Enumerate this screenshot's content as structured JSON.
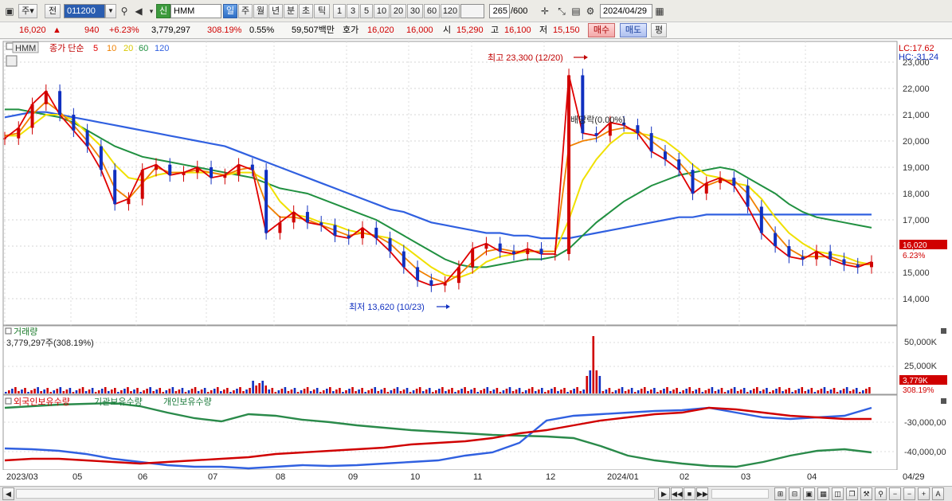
{
  "toolbar": {
    "period_toggle": "주",
    "prev_label": "전",
    "code": "011200",
    "badge_new": "신",
    "name": "HMM",
    "periods": [
      "일",
      "주",
      "월",
      "년",
      "분",
      "초",
      "틱"
    ],
    "active_period": "일",
    "ticks": [
      "1",
      "3",
      "5",
      "10",
      "20",
      "30",
      "60",
      "120"
    ],
    "count": "265",
    "count_total": "/600",
    "date": "2024/04/29"
  },
  "quote": {
    "price": "16,020",
    "arrow": "▲",
    "change": "940",
    "change_pct": "+6.23%",
    "volume": "3,779,297",
    "volume_ratio": "308.19%",
    "turnover": "0.55%",
    "amount": "59,507백만",
    "bid_label": "호가",
    "bid": "16,020",
    "ask": "16,000",
    "open_label": "시",
    "open": "15,290",
    "high_label": "고",
    "high": "16,100",
    "low_label": "저",
    "low": "15,150",
    "buy_label": "매수",
    "sell_label": "매도",
    "eval_label": "평"
  },
  "legend": {
    "name": "HMM",
    "type": "종가 단순",
    "ma": [
      {
        "label": "5",
        "color": "#e00000"
      },
      {
        "label": "10",
        "color": "#f08000"
      },
      {
        "label": "20",
        "color": "#e8d800"
      },
      {
        "label": "60",
        "color": "#209040"
      },
      {
        "label": "120",
        "color": "#3060e0"
      }
    ],
    "lc": "LC:17.62",
    "hc": "HC:-31.24"
  },
  "annotations": {
    "high": "최고 23,300 (12/20)",
    "low": "최저 13,620 (10/23)",
    "dividend": "배당락(0.00%)"
  },
  "price_axis": [
    "23,000",
    "22,000",
    "21,000",
    "20,000",
    "19,000",
    "18,000",
    "17,000",
    "16,000",
    "15,000",
    "14,000"
  ],
  "price_now": {
    "value": "16,020",
    "pct": "6.23%"
  },
  "volume_panel": {
    "title": "거래량",
    "value": "3,779,297주(308.19%)",
    "axis": [
      "50,000K",
      "25,000K"
    ],
    "now": "3,779K",
    "now_pct": "308.19%"
  },
  "holdings_panel": {
    "titles": [
      "외국인보유수량",
      "기관보유수량",
      "개인보유수량"
    ],
    "axis": [
      "-30,000,00",
      "-40,000,00"
    ]
  },
  "x_axis": [
    "2023/03",
    "05",
    "06",
    "07",
    "08",
    "09",
    "10",
    "11",
    "12",
    "2024/01",
    "02",
    "03",
    "04",
    "04/29"
  ],
  "colors": {
    "up": "#d00000",
    "down": "#1030c0",
    "ma5": "#e00000",
    "ma10": "#f08000",
    "ma20": "#f0e000",
    "ma60": "#209040",
    "ma120": "#3060e0"
  },
  "chart_data": {
    "type": "line",
    "ylim": [
      13600,
      23300
    ],
    "series": [
      {
        "name": "5",
        "values": [
          20100,
          20500,
          21400,
          21900,
          21000,
          20400,
          19800,
          18900,
          17600,
          17800,
          18900,
          19100,
          18700,
          18800,
          19000,
          18600,
          18700,
          19100,
          18900,
          16500,
          16900,
          17300,
          16900,
          16800,
          16400,
          16300,
          16700,
          16300,
          15800,
          15200,
          14700,
          14500,
          14600,
          15200,
          15900,
          16100,
          15800,
          15700,
          15900,
          15700,
          15700,
          22500,
          20300,
          20200,
          20700,
          20600,
          20300,
          19600,
          19300,
          18900,
          18000,
          18400,
          18600,
          18300,
          17500,
          16500,
          16000,
          15600,
          15500,
          15800,
          15500,
          15300,
          15200,
          15400
        ]
      },
      {
        "name": "10",
        "values": [
          20200,
          20300,
          21000,
          21500,
          21100,
          20600,
          20000,
          19300,
          18200,
          17800,
          18400,
          19000,
          18800,
          18800,
          18900,
          18800,
          18700,
          18900,
          19000,
          17600,
          17100,
          17100,
          17000,
          16800,
          16600,
          16400,
          16500,
          16400,
          16100,
          15600,
          15100,
          14800,
          14600,
          14900,
          15400,
          15800,
          15900,
          15800,
          15800,
          15800,
          15800,
          19800,
          20000,
          20100,
          20400,
          20500,
          20400,
          20000,
          19600,
          19200,
          18600,
          18300,
          18500,
          18500,
          18000,
          17200,
          16500,
          15900,
          15600,
          15600,
          15600,
          15400,
          15300,
          15300
        ]
      },
      {
        "name": "20",
        "values": [
          20200,
          20200,
          20600,
          21000,
          21000,
          20800,
          20300,
          19800,
          19100,
          18600,
          18500,
          18700,
          18800,
          18800,
          18800,
          18800,
          18700,
          18800,
          18800,
          18500,
          17700,
          17200,
          17100,
          16900,
          16800,
          16600,
          16500,
          16400,
          16300,
          16000,
          15600,
          15200,
          14900,
          14800,
          15000,
          15400,
          15600,
          15700,
          15800,
          15800,
          15800,
          17000,
          18500,
          19300,
          19900,
          20300,
          20300,
          20200,
          20000,
          19600,
          19100,
          18700,
          18600,
          18400,
          18300,
          17800,
          17100,
          16500,
          16100,
          15800,
          15700,
          15600,
          15400,
          15300
        ]
      },
      {
        "name": "60",
        "values": [
          21200,
          21200,
          21100,
          21000,
          20900,
          20700,
          20400,
          20100,
          19800,
          19600,
          19400,
          19300,
          19200,
          19100,
          19000,
          18900,
          18800,
          18700,
          18600,
          18400,
          18200,
          18100,
          18000,
          17800,
          17600,
          17400,
          17200,
          17000,
          16700,
          16400,
          16100,
          15800,
          15500,
          15300,
          15200,
          15200,
          15300,
          15400,
          15500,
          15500,
          15600,
          15900,
          16400,
          16900,
          17300,
          17700,
          18000,
          18300,
          18500,
          18700,
          18800,
          18900,
          19000,
          18900,
          18600,
          18300,
          18000,
          17600,
          17300,
          17100,
          17000,
          16900,
          16800,
          16700
        ]
      },
      {
        "name": "120",
        "values": [
          20900,
          21000,
          21100,
          21100,
          21000,
          20900,
          20800,
          20700,
          20600,
          20500,
          20400,
          20300,
          20200,
          20100,
          20000,
          19900,
          19800,
          19600,
          19400,
          19200,
          19000,
          18800,
          18600,
          18400,
          18200,
          18000,
          17800,
          17600,
          17400,
          17300,
          17100,
          16900,
          16800,
          16700,
          16600,
          16500,
          16500,
          16400,
          16400,
          16300,
          16300,
          16300,
          16400,
          16500,
          16600,
          16700,
          16800,
          16900,
          17000,
          17100,
          17100,
          17200,
          17200,
          17200,
          17200,
          17200,
          17200,
          17200,
          17200,
          17200,
          17200,
          17200,
          17200,
          17200
        ]
      }
    ]
  }
}
